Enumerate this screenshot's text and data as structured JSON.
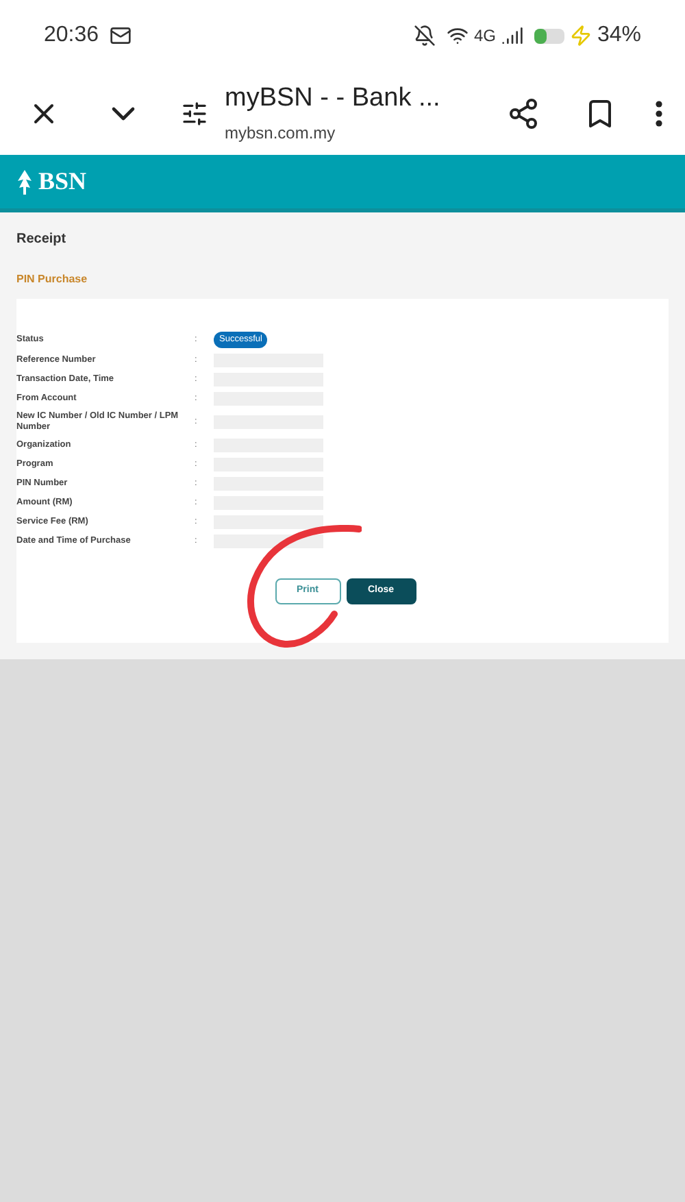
{
  "status_bar": {
    "time": "20:36",
    "battery": "34%",
    "network": "4G"
  },
  "browser": {
    "title": "myBSN - - Bank ...",
    "url": "mybsn.com.my"
  },
  "site": {
    "logo": "BSN"
  },
  "page": {
    "title": "Receipt",
    "section": "PIN Purchase"
  },
  "fields": [
    {
      "label": "Status",
      "separator": ":",
      "kind": "badge",
      "value": "Successful"
    },
    {
      "label": "Reference Number",
      "separator": ":",
      "kind": "hidden"
    },
    {
      "label": "Transaction Date, Time",
      "separator": ":",
      "kind": "hidden"
    },
    {
      "label": "From Account",
      "separator": ":",
      "kind": "hidden"
    },
    {
      "label": "New IC Number / Old IC Number / LPM Number",
      "separator": ":",
      "kind": "hidden"
    },
    {
      "label": "Organization",
      "separator": ":",
      "kind": "hidden"
    },
    {
      "label": "Program",
      "separator": ":",
      "kind": "hidden"
    },
    {
      "label": "PIN Number",
      "separator": ":",
      "kind": "hidden"
    },
    {
      "label": "Amount (RM)",
      "separator": ":",
      "kind": "hidden"
    },
    {
      "label": "Service Fee (RM)",
      "separator": ":",
      "kind": "hidden"
    },
    {
      "label": "Date and Time of Purchase",
      "separator": ":",
      "kind": "hidden"
    }
  ],
  "buttons": [
    {
      "label": "Print",
      "kind": "outline"
    },
    {
      "label": "Close",
      "kind": "primary"
    }
  ]
}
